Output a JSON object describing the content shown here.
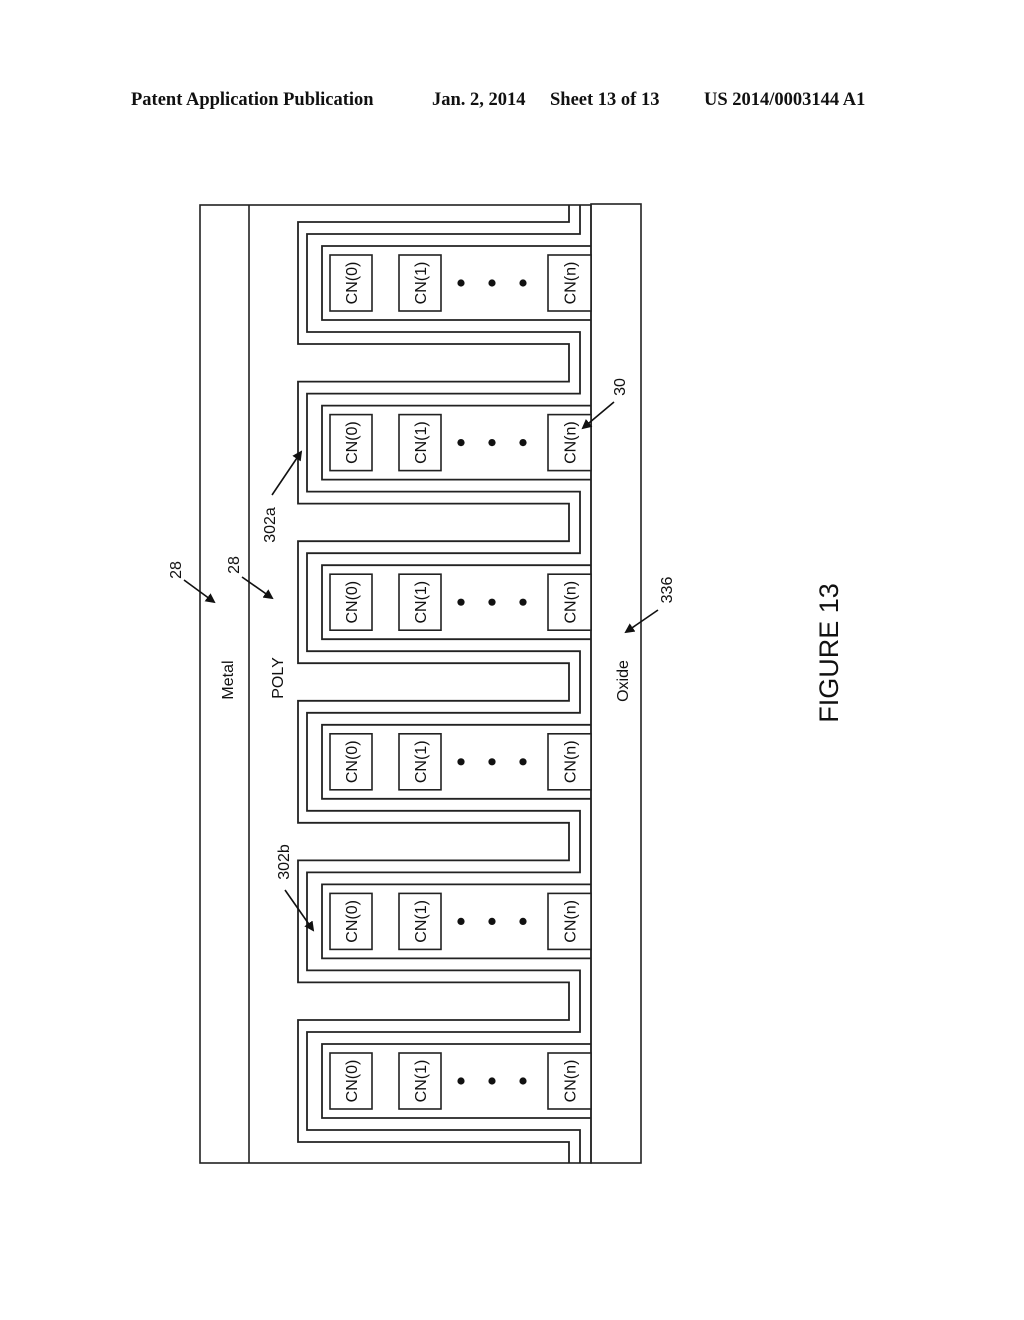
{
  "header": {
    "publication": "Patent Application Publication",
    "date": "Jan. 2, 2014",
    "sheet": "Sheet 13 of 13",
    "number": "US 2014/0003144 A1"
  },
  "figure": {
    "title": "FIGURE 13",
    "layers": {
      "metal": "Metal",
      "poly": "POLY",
      "oxide": "Oxide"
    },
    "reference_labels": {
      "metal_ref": "28",
      "poly_ref": "28",
      "fold_a": "302a",
      "fold_b": "302b",
      "nanotube_ref": "30",
      "oxide_ref": "336"
    },
    "cells": [
      {
        "elements": [
          "CN(0)",
          "CN(1)",
          "CN(n)"
        ],
        "ellipsis": "• • •"
      },
      {
        "elements": [
          "CN(0)",
          "CN(1)",
          "CN(n)"
        ],
        "ellipsis": "• • •"
      },
      {
        "elements": [
          "CN(0)",
          "CN(1)",
          "CN(n)"
        ],
        "ellipsis": "• • •"
      },
      {
        "elements": [
          "CN(0)",
          "CN(1)",
          "CN(n)"
        ],
        "ellipsis": "• • •"
      },
      {
        "elements": [
          "CN(0)",
          "CN(1)",
          "CN(n)"
        ],
        "ellipsis": "• • •"
      },
      {
        "elements": [
          "CN(0)",
          "CN(1)",
          "CN(n)"
        ],
        "ellipsis": "• • •"
      }
    ]
  }
}
